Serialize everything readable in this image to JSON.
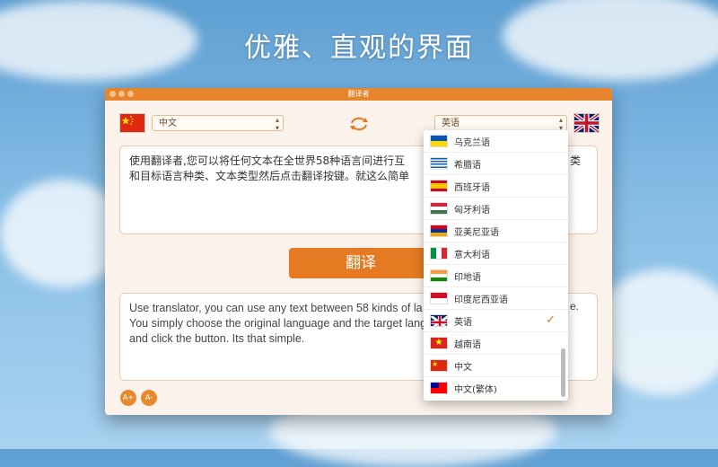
{
  "headline": "优雅、直观的界面",
  "window": {
    "title": "翻译者"
  },
  "source_language": "中文",
  "target_language": "英语",
  "source_text": "使用翻译者,您可以将任何文本在全世界58种语言间进行互\n和目标语言种类、文本类型然后点击翻译按键。就这么简单",
  "translate_label": "翻译",
  "output_text": "Use translator, you can use any text between 58 kinds of la\nYou simply choose the original language and the target lang\nand click the button. Its that simple.",
  "side_fragment_1": "类",
  "side_fragment_2": "e.",
  "font_buttons": {
    "increase": "A+",
    "decrease": "A-"
  },
  "dropdown": {
    "items": [
      {
        "label": "乌克兰语",
        "flag": "ukraine-flag"
      },
      {
        "label": "希腊语",
        "flag": "greece-flag"
      },
      {
        "label": "西班牙语",
        "flag": "spain-flag"
      },
      {
        "label": "匈牙利语",
        "flag": "hungary-flag"
      },
      {
        "label": "亚美尼亚语",
        "flag": "armenia-flag"
      },
      {
        "label": "意大利语",
        "flag": "italy-flag"
      },
      {
        "label": "印地语",
        "flag": "india-flag"
      },
      {
        "label": "印度尼西亚语",
        "flag": "indonesia-flag"
      },
      {
        "label": "英语",
        "flag": "uk-flag",
        "selected": true
      },
      {
        "label": "越南语",
        "flag": "vietnam-flag"
      },
      {
        "label": "中文",
        "flag": "china-flag"
      },
      {
        "label": "中文(繁体)",
        "flag": "taiwan-flag"
      }
    ]
  },
  "colors": {
    "accent": "#e57a22",
    "window_bg": "#fbf3eb",
    "sky": "#86bde6"
  }
}
